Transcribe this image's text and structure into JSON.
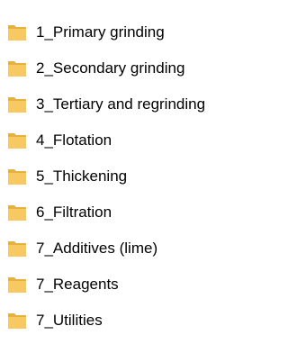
{
  "folders": [
    {
      "label": "1_Primary grinding",
      "icon": "folder-icon"
    },
    {
      "label": "2_Secondary grinding",
      "icon": "folder-icon"
    },
    {
      "label": "3_Tertiary and regrinding",
      "icon": "folder-icon"
    },
    {
      "label": "4_Flotation",
      "icon": "folder-icon"
    },
    {
      "label": "5_Thickening",
      "icon": "folder-icon"
    },
    {
      "label": "6_Filtration",
      "icon": "folder-icon"
    },
    {
      "label": "7_Additives (lime)",
      "icon": "folder-icon"
    },
    {
      "label": "7_Reagents",
      "icon": "folder-icon"
    },
    {
      "label": "7_Utilities",
      "icon": "folder-icon"
    }
  ],
  "colors": {
    "folder_front": "#F8C963",
    "folder_back": "#E8B040",
    "text": "#000000"
  }
}
